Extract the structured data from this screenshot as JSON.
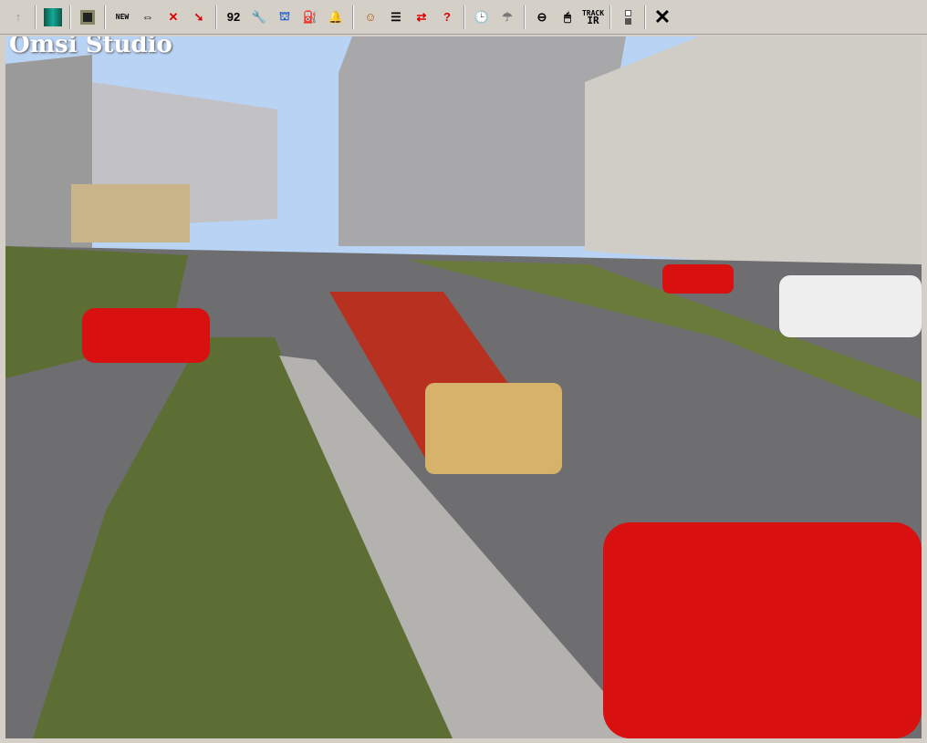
{
  "app_title": "Omsi Studio",
  "toolbar": {
    "up": "↑",
    "map": "▦",
    "save": "💾",
    "new_label": "NEW",
    "swap": "⇔",
    "delete": "✕",
    "pin": "➘",
    "timetable": "92",
    "wrench": "🔧",
    "depot": "⛫",
    "fuel": "⛽",
    "bell": "🔔",
    "driver": "☺",
    "list": "☰",
    "pc_swap": "⇄",
    "help": "?",
    "clock": "🕒",
    "weather": "☂",
    "wheel": "⊖",
    "mouse": "🖱",
    "track_ir_top": "TRACK",
    "track_ir_bottom": "IR",
    "close": "✕"
  },
  "colors": {
    "toolbar": "#d4d0c8",
    "sky": "#b9d3f5",
    "road": "#6e6e70",
    "grass": "#5d6e35",
    "car": "#d81010"
  }
}
